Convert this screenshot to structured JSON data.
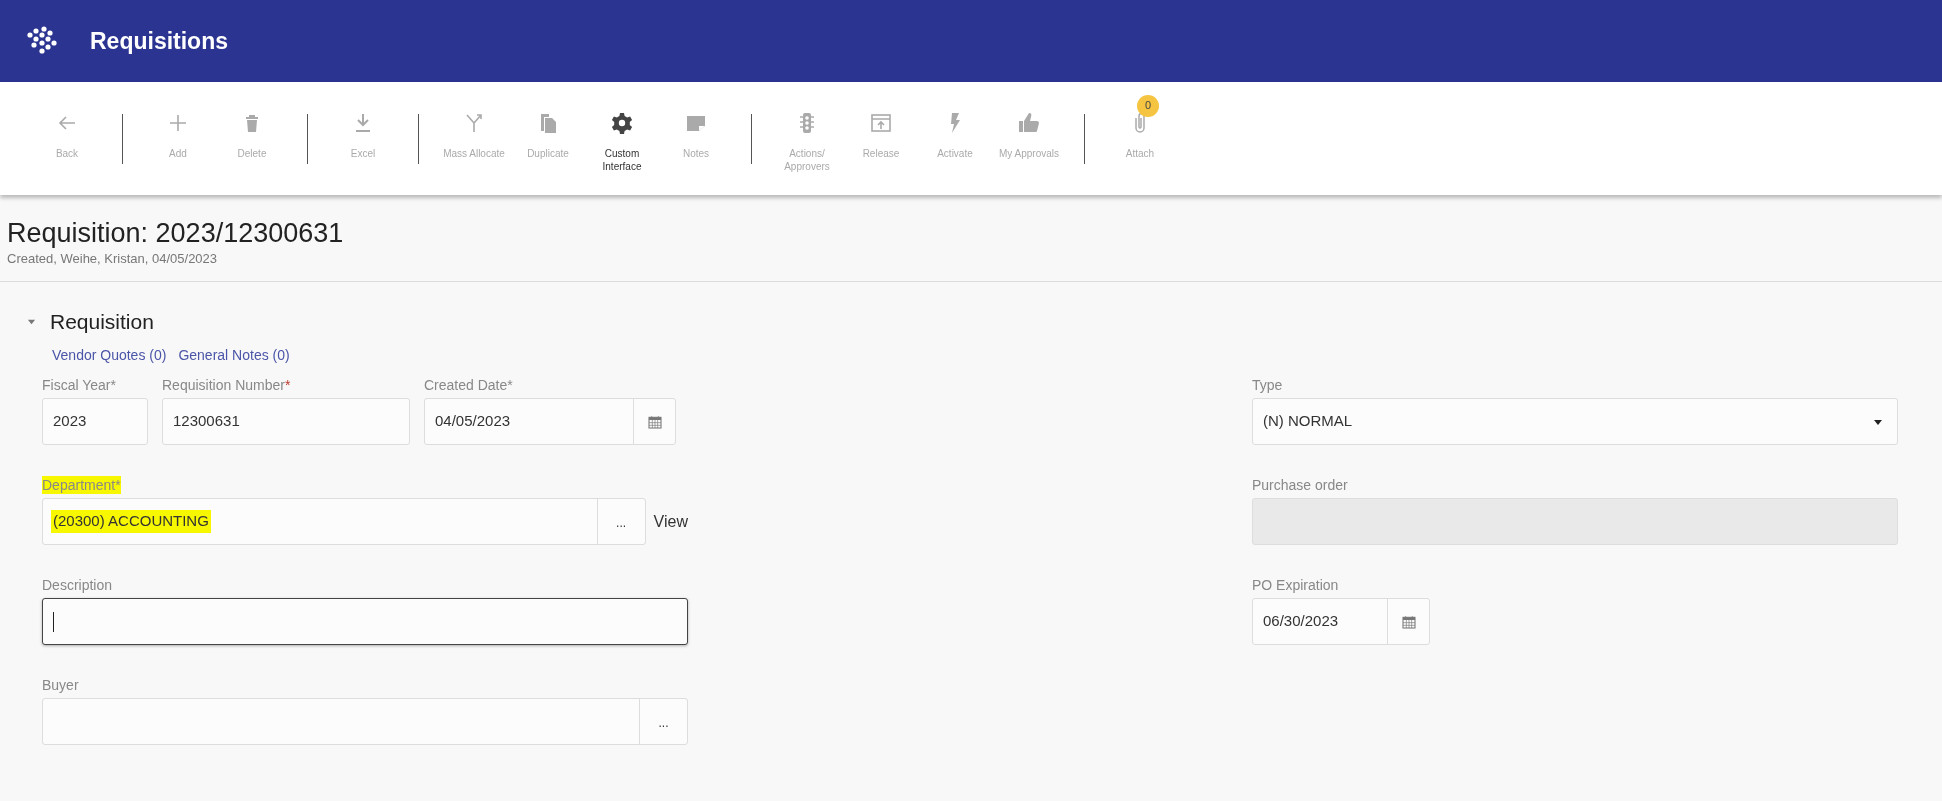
{
  "app_bar": {
    "title": "Requisitions"
  },
  "toolbar": {
    "groups": [
      [
        {
          "kind": "back",
          "label": "Back",
          "disabled": true
        }
      ],
      [
        {
          "kind": "add",
          "label": "Add",
          "disabled": true
        },
        {
          "kind": "delete",
          "label": "Delete",
          "disabled": true
        }
      ],
      [
        {
          "kind": "download",
          "label": "Excel",
          "disabled": true
        }
      ],
      [
        {
          "kind": "fork",
          "label": "Mass Allocate",
          "disabled": true
        },
        {
          "kind": "copy",
          "label": "Duplicate",
          "disabled": true
        },
        {
          "kind": "gear",
          "label": "Custom Interface",
          "disabled": false
        },
        {
          "kind": "note",
          "label": "Notes",
          "disabled": true
        }
      ],
      [
        {
          "kind": "traffic",
          "label": "Actions/ Approvers",
          "disabled": true
        },
        {
          "kind": "release",
          "label": "Release",
          "disabled": true
        },
        {
          "kind": "bolt",
          "label": "Activate",
          "disabled": true
        },
        {
          "kind": "thumb",
          "label": "My Approvals",
          "disabled": true
        }
      ],
      [
        {
          "kind": "clip",
          "label": "Attach",
          "disabled": true,
          "badge": "0"
        }
      ]
    ]
  },
  "page": {
    "title": "Requisition: 2023/12300631",
    "subtitle": "Created, Weihe, Kristan, 04/05/2023"
  },
  "section": {
    "title": "Requisition",
    "expanded": true,
    "links": [
      "Vendor Quotes (0)",
      "General Notes (0)"
    ]
  },
  "left_column": [
    [
      {
        "kind": "text",
        "label": "Fiscal Year",
        "required_mark": "*",
        "mark_alert": false,
        "value": "2023",
        "disabled": false,
        "focused": false,
        "highlighted": false
      },
      {
        "kind": "text",
        "label": "Requisition Number",
        "required_mark": "*",
        "mark_alert": true,
        "value": "12300631",
        "disabled": false,
        "focused": false,
        "highlighted": false
      },
      {
        "kind": "date",
        "label": "Created Date",
        "required_mark": "*",
        "mark_alert": false,
        "value": "04/05/2023",
        "disabled": false,
        "focused": false,
        "highlighted": false
      }
    ],
    [
      {
        "kind": "lookup",
        "label": "Department",
        "required_mark": "*",
        "mark_alert": false,
        "value": "(20300) ACCOUNTING",
        "button": "...",
        "link": "View",
        "disabled": false,
        "focused": false,
        "highlighted": true
      }
    ],
    [
      {
        "kind": "text",
        "label": "Description",
        "disabled": false,
        "focused": true,
        "highlighted": false
      }
    ],
    [
      {
        "kind": "lookup",
        "label": "Buyer",
        "button": "...",
        "disabled": false,
        "focused": false,
        "highlighted": false
      }
    ]
  ],
  "right_column": [
    {
      "kind": "select",
      "label": "Type",
      "value": "(N) NORMAL",
      "disabled": false,
      "focused": false,
      "highlighted": false
    },
    {
      "kind": "text",
      "label": "Purchase order",
      "disabled": true,
      "focused": false,
      "highlighted": false
    },
    {
      "kind": "date",
      "label": "PO Expiration",
      "value": "06/30/2023",
      "disabled": false,
      "focused": false,
      "highlighted": false
    }
  ]
}
